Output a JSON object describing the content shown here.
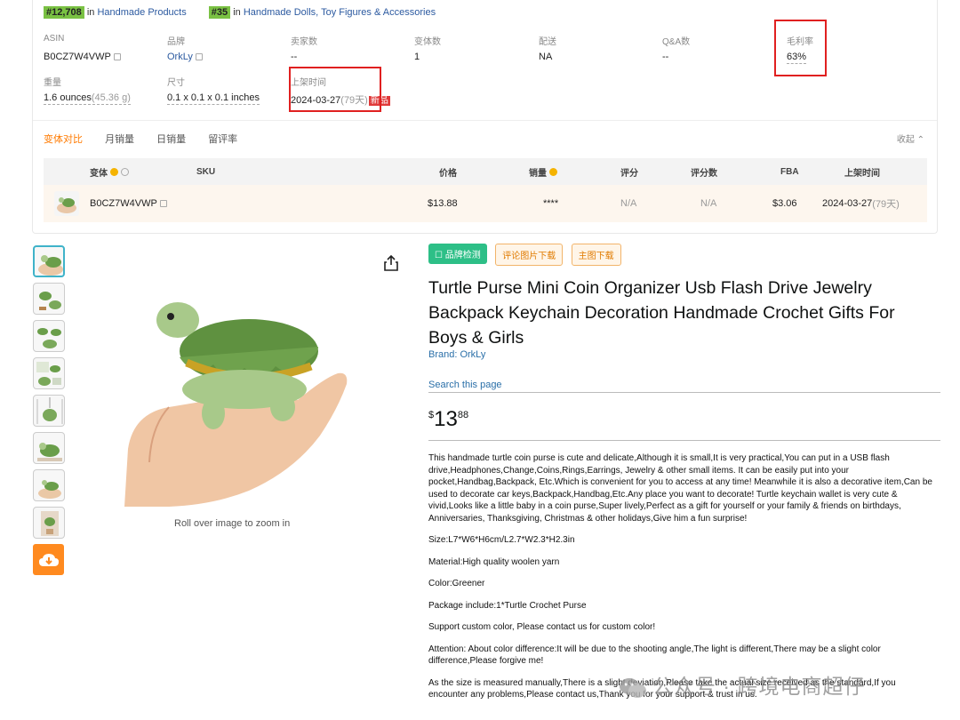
{
  "ranks": [
    {
      "badge": "#12,708",
      "prefix": "in",
      "category": "Handmade Products"
    },
    {
      "badge": "#35",
      "prefix": "in",
      "category": "Handmade Dolls, Toy Figures & Accessories"
    }
  ],
  "meta_row1": [
    {
      "label": "ASIN",
      "value": "B0CZ7W4VWP"
    },
    {
      "label": "品牌",
      "value": "OrkLy"
    },
    {
      "label": "卖家数",
      "value": "--"
    },
    {
      "label": "变体数",
      "value": "1"
    },
    {
      "label": "配送",
      "value": "NA"
    },
    {
      "label": "Q&A数",
      "value": "--"
    },
    {
      "label": "毛利率",
      "value": "63%"
    }
  ],
  "meta_row2": [
    {
      "label": "重量",
      "value": "1.6 ounces",
      "sub": "(45.36 g)"
    },
    {
      "label": "尺寸",
      "value": "0.1 x 0.1 x 0.1 inches"
    },
    {
      "label": "上架时间",
      "value": "2024-03-27",
      "sub": "(79天)",
      "tag": "新品"
    }
  ],
  "tabs": [
    "变体对比",
    "月销量",
    "日销量",
    "留评率"
  ],
  "collapse_label": "收起",
  "variant_table": {
    "headers": {
      "variant": "变体",
      "sku": "SKU",
      "price": "价格",
      "sales": "销量",
      "rating": "评分",
      "reviews": "评分数",
      "fba": "FBA",
      "listed": "上架时间"
    },
    "row": {
      "asin": "B0CZ7W4VWP",
      "sku": "",
      "price": "$13.88",
      "sales": "****",
      "rating": "N/A",
      "reviews": "N/A",
      "fba": "$3.06",
      "listed": "2024-03-27",
      "listed_sub": "(79天)"
    }
  },
  "tool_buttons": {
    "brand_check": "品牌检测",
    "review_images": "评论图片下载",
    "main_images": "主图下载"
  },
  "product": {
    "title": "Turtle Purse Mini Coin Organizer Usb Flash Drive Jewelry Backpack Keychain Decoration Handmade Crochet Gifts For Boys & Girls",
    "brand": "Brand: OrkLy",
    "search_page": "Search this page",
    "price_symbol": "$",
    "price_whole": "13",
    "price_fraction": "88",
    "zoom_hint": "Roll over image to zoom in"
  },
  "description": [
    "This handmade turtle coin purse is cute and delicate,Although it is small,It is very practical,You can put in a USB flash drive,Headphones,Change,Coins,Rings,Earrings, Jewelry & other small items. It can be easily put into your pocket,Handbag,Backpack, Etc.Which is convenient for you to access at any time! Meanwhile it is also a decorative item,Can be used to decorate car keys,Backpack,Handbag,Etc.Any place you want to decorate! Turtle keychain wallet is very cute & vivid,Looks like a little baby in a coin purse,Super lively,Perfect as a gift for yourself or your family & friends on birthdays, Anniversaries, Thanksgiving, Christmas & other holidays,Give him a fun surprise!",
    "Size:L7*W6*H6cm/L2.7*W2.3*H2.3in",
    "Material:High quality woolen yarn",
    "Color:Greener",
    "Package include:1*Turtle Crochet Purse",
    "Support custom color, Please contact us for custom color!",
    "Attention: About color difference:It will be due to the shooting angle,The light is different,There may be a slight color difference,Please forgive me!",
    "As the size is measured manually,There is a slight deviation,Please take the actual size received as the standard,If you encounter any problems,Please contact us,Thank you for your support & trust in us."
  ],
  "watermark": "公众号 · 跨境电商超仔",
  "colors": {
    "accent_orange": "#ff7a00",
    "rank_green": "#7ac143",
    "highlight_red": "#e02020",
    "brand_check_green": "#2dbf87",
    "link_blue": "#2a6fa8"
  }
}
